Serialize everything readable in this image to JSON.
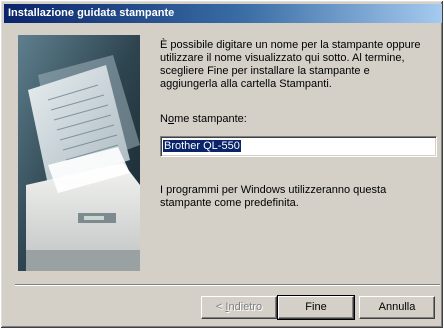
{
  "window": {
    "title": "Installazione guidata stampante"
  },
  "content": {
    "description": "È possibile digitare un nome per la stampante oppure utilizzare il nome visualizzato qui sotto. Al termine, scegliere Fine per installare la stampante e aggiungerla alla cartella Stampanti.",
    "name_label_pre": "N",
    "name_label_accel": "o",
    "name_label_post": "me stampante:",
    "name_value": "Brother QL-550",
    "note": "I programmi per Windows utilizzeranno questa stampante come predefinita."
  },
  "buttons": {
    "back_pre": "< ",
    "back_accel": "I",
    "back_post": "ndietro",
    "finish": "Fine",
    "cancel": "Annulla"
  },
  "illustration": {
    "icon": "printer-illustration"
  }
}
